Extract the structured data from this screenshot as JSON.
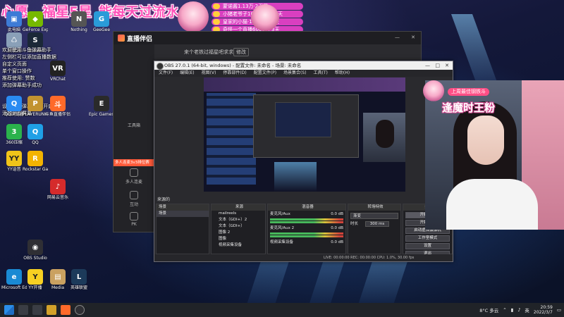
{
  "banner": {
    "title_part1": "心愿",
    "title_part2": "福星5星",
    "title_part3": "能每天过流水",
    "badges": [
      "蒙诺酱1.13万·2天了",
      "小猪老爷子10000万分·3天",
      "皇家的小猫·15000万·3天",
      "奇怪一个直播6000万·3天"
    ]
  },
  "desktop": {
    "notes": [
      "欢迎使用斗鱼弹幕助手",
      "左侧栏可以添加直播数据",
      "...",
      "自定义页面",
      "单个窗口操作",
      "推荐使用: 赞数",
      "添加弹幕助手成功",
      "",
      "设置显示弹幕 功能开启",
      "添加到副屏幕"
    ],
    "icons": [
      {
        "label": "此电脑",
        "color": "#3d7bd6",
        "glyph": "▣"
      },
      {
        "label": "GeForce Experience",
        "color": "#76b900",
        "glyph": "◆"
      },
      {
        "label": "Nothing",
        "color": "#555555",
        "glyph": "N"
      },
      {
        "label": "GeeGee",
        "color": "#2a9bd8",
        "glyph": "G"
      },
      {
        "label": "回收站",
        "color": "#8aa0b8",
        "glyph": "♺"
      },
      {
        "label": "Steam",
        "color": "#1b2838",
        "glyph": "S"
      },
      {
        "label": "VRChat",
        "color": "#222222",
        "glyph": "VR"
      },
      {
        "label": "QQ浏览器",
        "color": "#2a8bf2",
        "glyph": "Q"
      },
      {
        "label": "PLAYERUNKNOWN",
        "color": "#c29330",
        "glyph": "P"
      },
      {
        "label": "斗鱼直播伴侣",
        "color": "#ff6a2a",
        "glyph": "斗"
      },
      {
        "label": "Epic Games Launcher",
        "color": "#2a2a2a",
        "glyph": "E"
      },
      {
        "label": "360压缩",
        "color": "#2bb24c",
        "glyph": "3"
      },
      {
        "label": "QQ",
        "color": "#1fa0e6",
        "glyph": "Q"
      },
      {
        "label": "YY语音",
        "color": "#f0c419",
        "glyph": "YY"
      },
      {
        "label": "Rockstar Games",
        "color": "#f3b300",
        "glyph": "R"
      },
      {
        "label": "网易云音乐",
        "color": "#d52b2b",
        "glyph": "♪"
      },
      {
        "label": "OBS Studio",
        "color": "#2f2f34",
        "glyph": "◉"
      },
      {
        "label": "Microsoft Edge",
        "color": "#1a8ad3",
        "glyph": "e"
      },
      {
        "label": "YY开播",
        "color": "#f7d022",
        "glyph": "Y"
      },
      {
        "label": "Media",
        "color": "#caa160",
        "glyph": "▤"
      },
      {
        "label": "英雄联盟",
        "color": "#1c3a5a",
        "glyph": "L"
      }
    ]
  },
  "helper": {
    "app_name": "直播伴侣",
    "stream_title": "来个老铁过福星吧求求",
    "edit_label": "修改",
    "side_items": [
      "工具箱",
      "多人连麦",
      "互动",
      "PK",
      "弹幕"
    ],
    "multi_label": "多人连麦3v3排位赛"
  },
  "obs": {
    "title": "OBS 27.0.1 (64-bit, windows) - 配置文件: 未命名 - 场景: 未命名",
    "menu": [
      "文件(F)",
      "编辑(E)",
      "视图(V)",
      "停靠部件(D)",
      "配置文件(P)",
      "场景集合(S)",
      "工具(T)",
      "帮助(H)"
    ],
    "scene_header": "来源的",
    "panels": {
      "scenes_title": "场景",
      "sources_title": "来源",
      "mixer_title": "混音器",
      "transitions_title": "转场特效",
      "controls_title": "控件"
    },
    "scenes": [
      "场景"
    ],
    "sources": [
      "mailreels",
      "文本（GDI+）2",
      "文本（GDI+）",
      "图像 2",
      "图像",
      "视频采集设备"
    ],
    "mixer": [
      {
        "name": "麦克风/Aux",
        "db": "0.0 dB"
      },
      {
        "name": "麦克风/Aux 2",
        "db": "0.0 dB"
      },
      {
        "name": "视频采集设备",
        "db": "0.0 dB"
      }
    ],
    "transition": {
      "type": "渐变",
      "duration_label": "时长",
      "duration": "300 ms"
    },
    "controls": [
      "开始推流",
      "开始录制",
      "启动虚拟摄像机",
      "工作室模式",
      "设置",
      "退出"
    ],
    "status": "LIVE: 00:00:00   REC: 00:00:00   CPU: 1.0%, 30.00 fps"
  },
  "cam": {
    "subtitle": "上周最佳钢铁斗",
    "title": "逢魔时王粉"
  },
  "taskbar": {
    "weather": "8°C 多云",
    "lang": "英",
    "time": "20:59",
    "date": "2022/3/7"
  }
}
